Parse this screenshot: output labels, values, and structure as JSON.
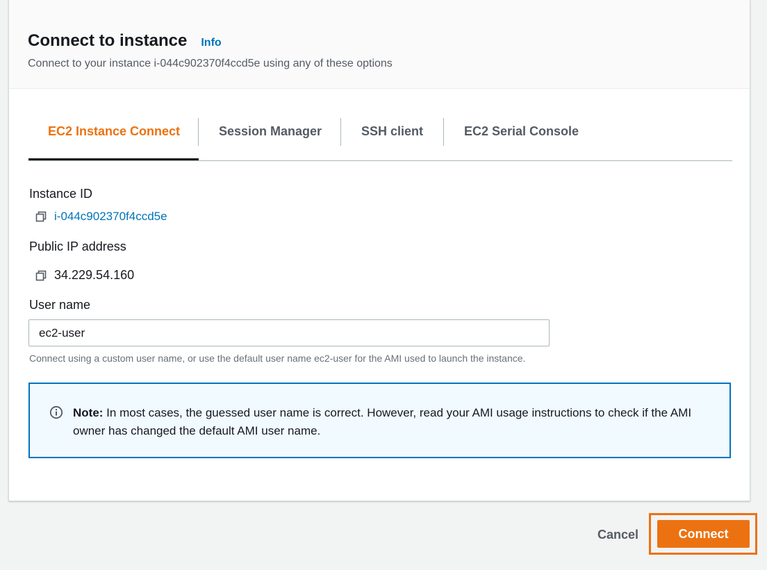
{
  "header": {
    "title": "Connect to instance",
    "info_label": "Info",
    "subtitle": "Connect to your instance i-044c902370f4ccd5e using any of these options"
  },
  "tabs": [
    {
      "label": "EC2 Instance Connect",
      "active": true
    },
    {
      "label": "Session Manager",
      "active": false
    },
    {
      "label": "SSH client",
      "active": false
    },
    {
      "label": "EC2 Serial Console",
      "active": false
    }
  ],
  "instance_id": {
    "label": "Instance ID",
    "value": "i-044c902370f4ccd5e",
    "icon": "copy-icon"
  },
  "public_ip": {
    "label": "Public IP address",
    "value": "34.229.54.160",
    "icon": "copy-icon"
  },
  "user_name": {
    "label": "User name",
    "value": "ec2-user",
    "hint": "Connect using a custom user name, or use the default user name ec2-user for the AMI used to launch the instance."
  },
  "note": {
    "icon": "info-circle-icon",
    "bold": "Note:",
    "text": " In most cases, the guessed user name is correct. However, read your AMI usage instructions to check if the AMI owner has changed the default AMI user name."
  },
  "footer": {
    "cancel_label": "Cancel",
    "connect_label": "Connect"
  },
  "colors": {
    "accent_orange": "#ec7211",
    "link_blue": "#0073bb",
    "note_border": "#0073bb",
    "text_secondary": "#545b64"
  }
}
